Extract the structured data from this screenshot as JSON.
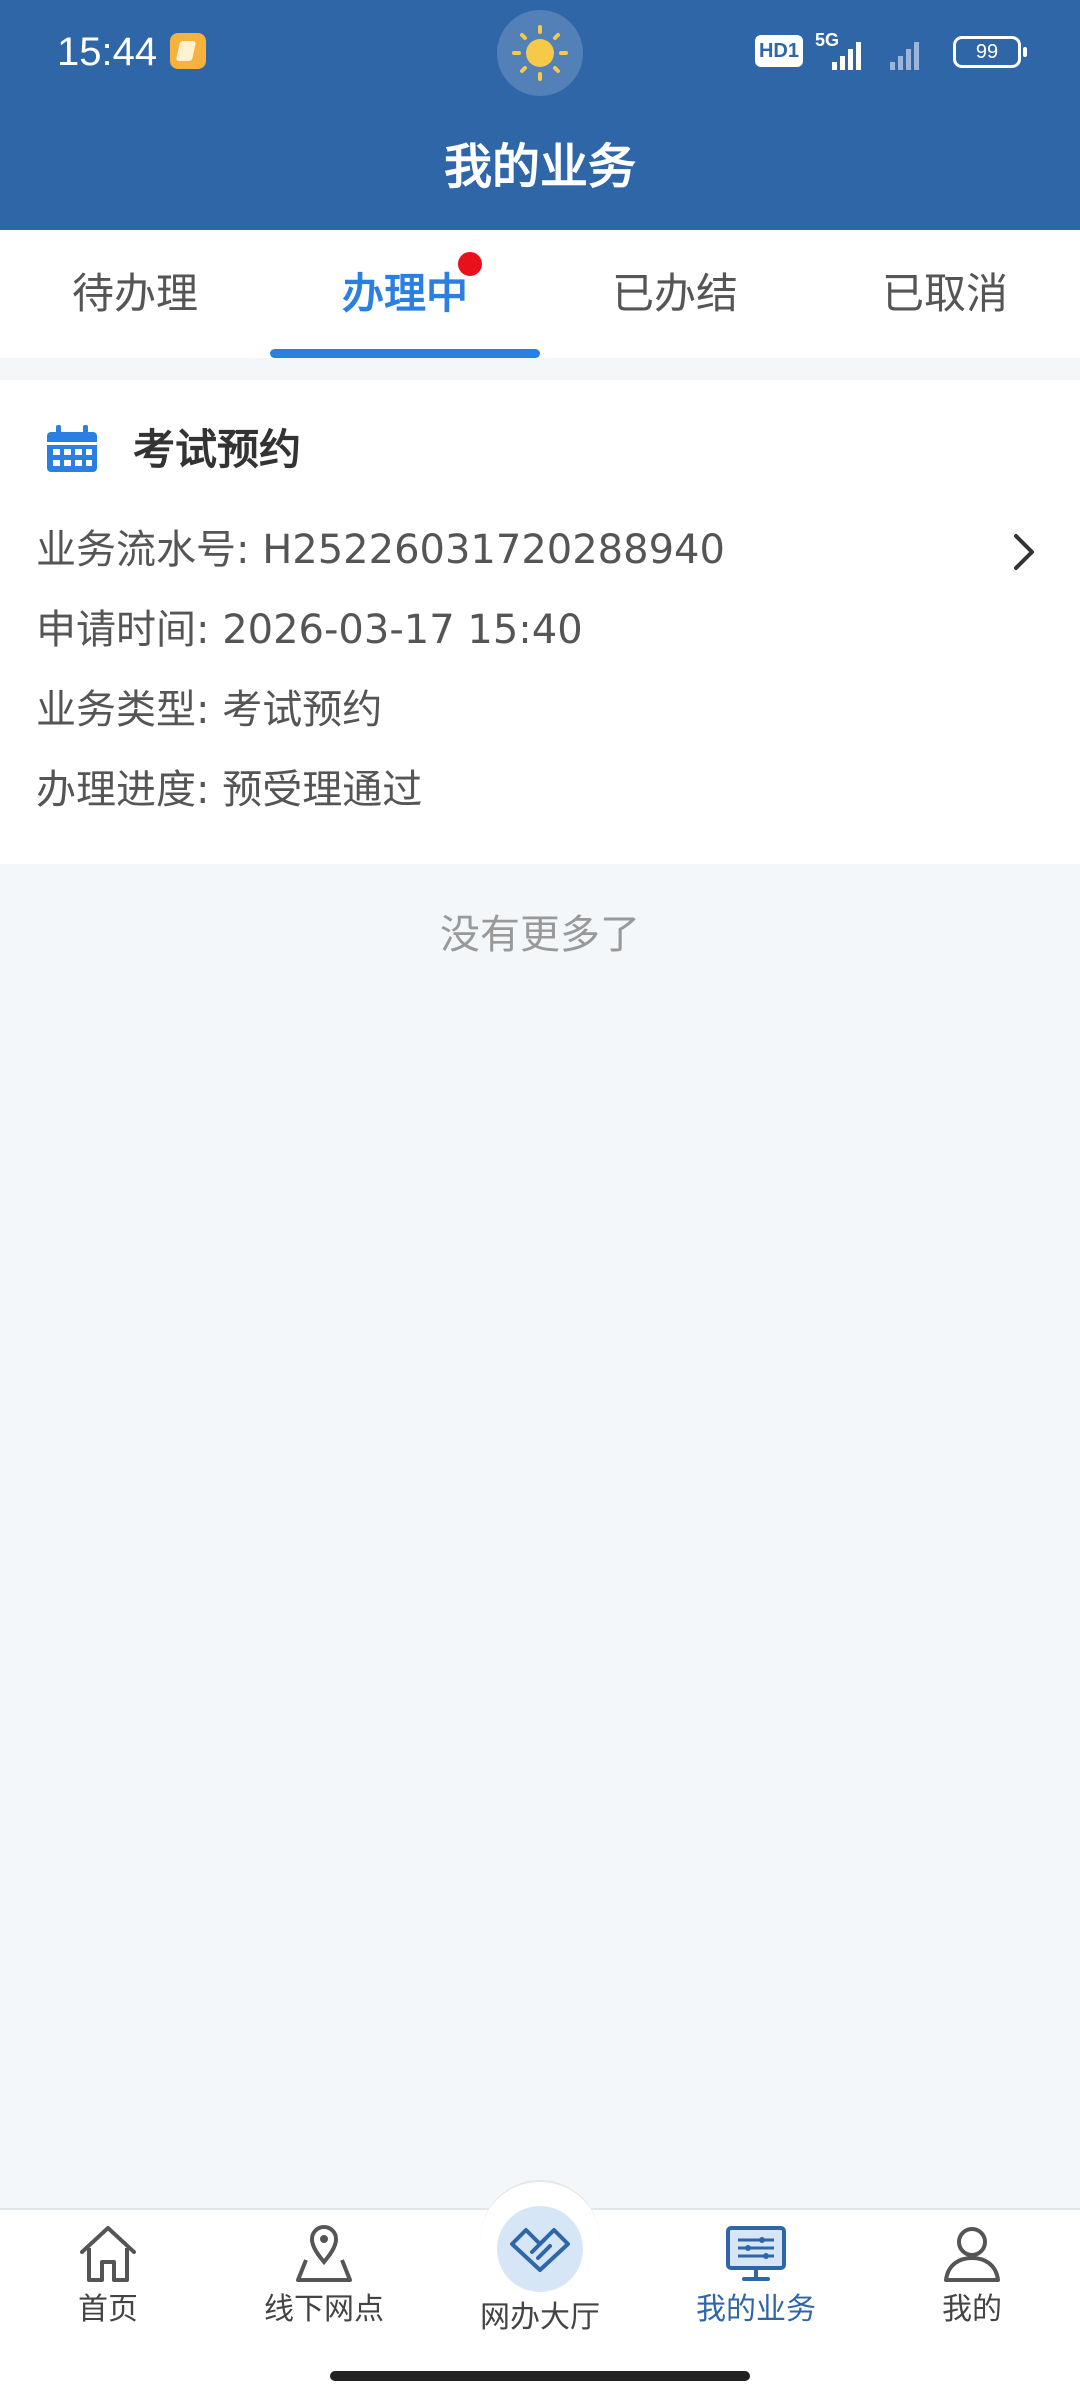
{
  "status_bar": {
    "time": "15:44",
    "network_badge": "HD1",
    "network_type": "5G",
    "battery": "99"
  },
  "header": {
    "title": "我的业务"
  },
  "tabs": [
    {
      "label": "待办理"
    },
    {
      "label": "办理中",
      "active": true,
      "has_dot": true
    },
    {
      "label": "已办结"
    },
    {
      "label": "已取消"
    }
  ],
  "card": {
    "icon": "calendar-icon",
    "title": "考试预约",
    "rows": [
      {
        "label": "业务流水号:",
        "value": "H25226031720288940"
      },
      {
        "label": "申请时间:",
        "value": "2026-03-17 15:40"
      },
      {
        "label": "业务类型:",
        "value": "考试预约"
      },
      {
        "label": "办理进度:",
        "value": "预受理通过"
      }
    ]
  },
  "list_footer": "没有更多了",
  "bottom_nav": [
    {
      "label": "首页",
      "icon": "home-icon"
    },
    {
      "label": "线下网点",
      "icon": "map-pin-icon"
    },
    {
      "label": "网办大厅",
      "icon": "handshake-icon"
    },
    {
      "label": "我的业务",
      "icon": "monitor-icon",
      "active": true
    },
    {
      "label": "我的",
      "icon": "user-icon"
    }
  ],
  "colors": {
    "header_bg": "#2e66a8",
    "accent": "#2b7fe0",
    "badge_red": "#e8101a",
    "page_bg": "#f4f7f9"
  }
}
